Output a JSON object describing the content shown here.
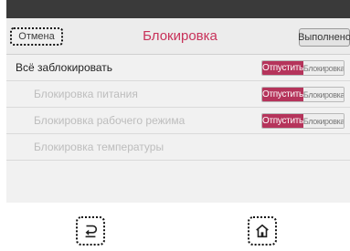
{
  "header": {
    "cancel_label": "Отмена",
    "title": "Блокировка",
    "done_label": "Выполнено"
  },
  "rows": [
    {
      "label": "Всё заблокировать",
      "toggle_on": "Отпустить",
      "toggle_off": "Блокировка",
      "enabled": true
    },
    {
      "label": "Блокировка питания",
      "toggle_on": "Отпустить",
      "toggle_off": "Блокировка",
      "enabled": false
    },
    {
      "label": "Блокировка рабочего режима",
      "toggle_on": "Отпустить",
      "toggle_off": "Блокировка",
      "enabled": false
    },
    {
      "label": "Блокировка температуры",
      "enabled": false
    }
  ],
  "nav": {
    "back_icon": "back-arrow-icon",
    "home_icon": "home-icon"
  },
  "colors": {
    "accent": "#b5345b",
    "title": "#c8325a",
    "disabled_text": "#bdbdbd"
  }
}
